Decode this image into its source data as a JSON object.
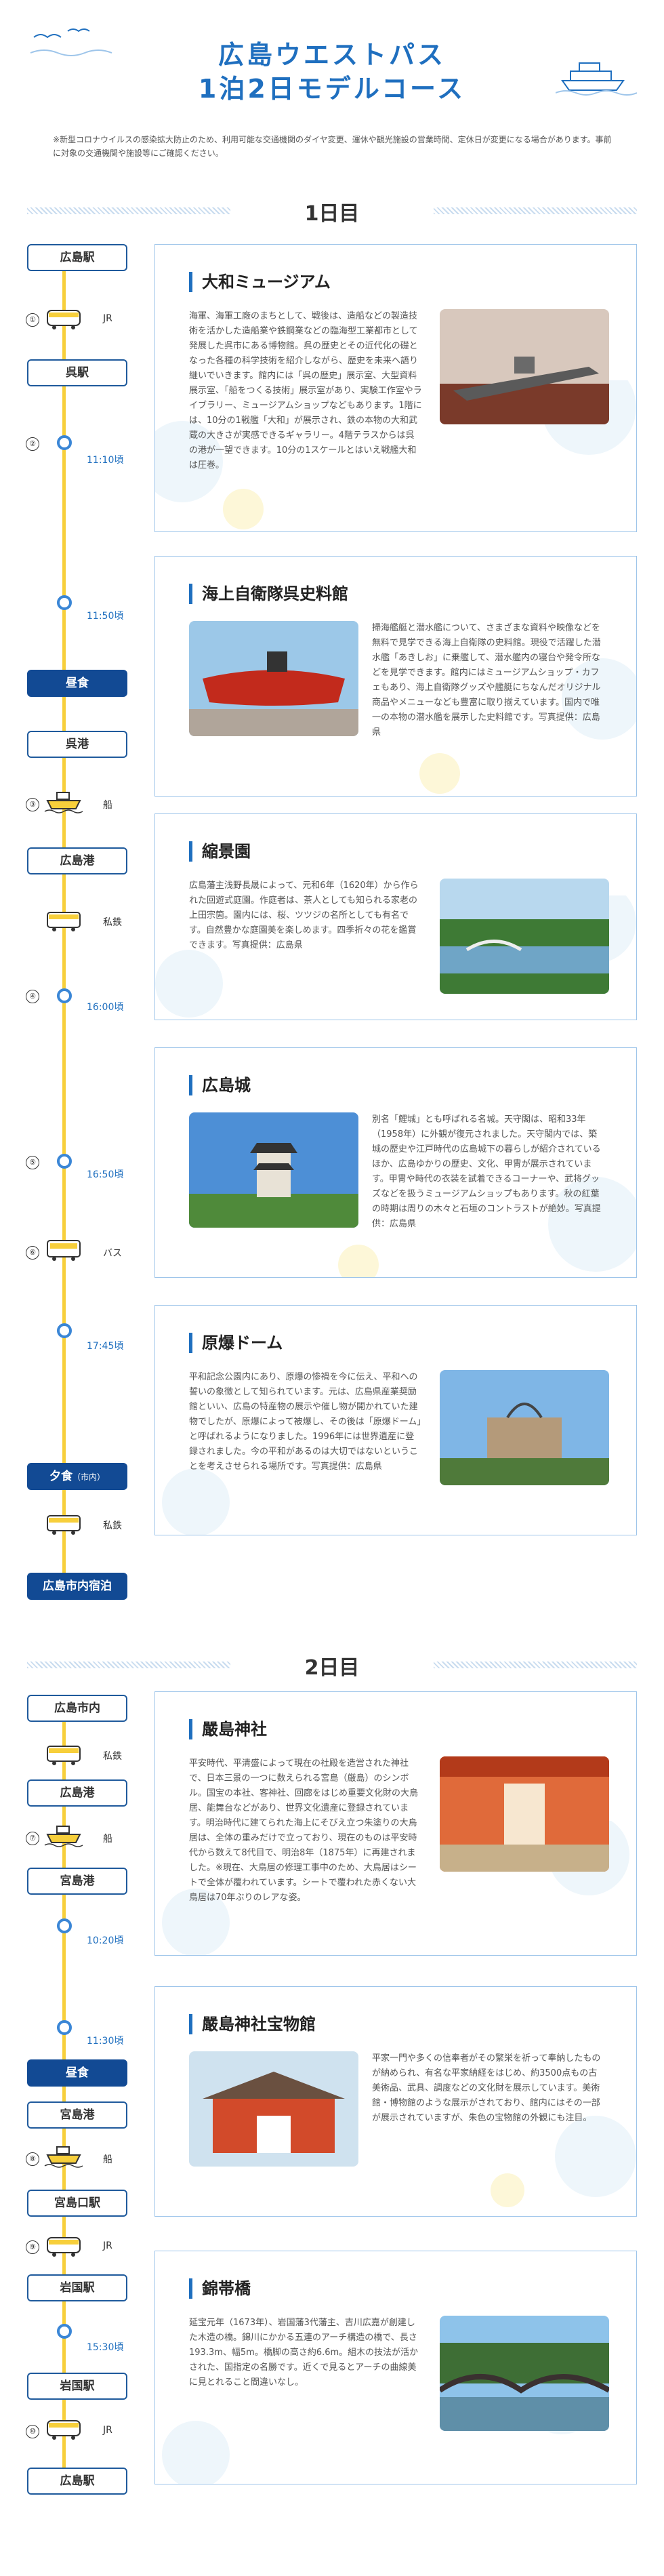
{
  "header": {
    "title_line1": "広島ウエストパス",
    "title_line2": "1泊2日モデルコース"
  },
  "note": "※新型コロナウイルスの感染拡大防止のため、利用可能な交通機関のダイヤ変更、運休や観光施設の営業時間、定休日が変更になる場合があります。事前に対象の交通機関や施設等にご確認ください。",
  "day1": {
    "label": "1日目",
    "timeline": {
      "station1": "広島駅",
      "n1": "①",
      "m1": "JR",
      "station2": "呉駅",
      "n2": "②",
      "t1": "11:10頃",
      "t2": "11:50頃",
      "meal1": "昼食",
      "station3": "呉港",
      "n3": "③",
      "m3": "船",
      "station4": "広島港",
      "m4": "私鉄",
      "n4": "④",
      "t3": "16:00頃",
      "n5": "⑤",
      "t4": "16:50頃",
      "n6": "⑥",
      "m6": "バス",
      "t5": "17:45頃",
      "meal2": "夕食",
      "meal2_sub": "（市内）",
      "m7": "私鉄",
      "stay": "広島市内宿泊"
    },
    "spots": [
      {
        "name": "大和ミュージアム",
        "desc": "海軍、海軍工廠のまちとして、戦後は、造船などの製造技術を活かした造船業や鉄鋼業などの臨海型工業都市として発展した呉市にある博物館。呉の歴史とその近代化の礎となった各種の科学技術を紹介しながら、歴史を未来へ語り継いでいきます。館内には「呉の歴史」展示室、大型資料展示室、「船をつくる技術」展示室があり、実験工作室やライブラリー、ミュージアムショップなどもあります。1階には、10分の1戦艦「大和」が展示され、鉄の本物の大和武蔵の大きさが実感できるギャラリー。4階テラスからは呉の港が一望できます。10分の1スケールとはいえ戦艦大和は圧巻。"
      },
      {
        "name": "海上自衛隊呉史料館",
        "desc": "掃海艦艇と潜水艦について、さまざまな資料や映像などを無料で見学できる海上自衛隊の史料館。現役で活躍した潜水艦「あきしお」に乗艦して、潜水艦内の寝台や発令所などを見学できます。館内にはミュージアムショップ・カフェもあり、海上自衛隊グッズや艦艇にちなんだオリジナル商品やメニューなども豊富に取り揃えています。国内で唯一の本物の潜水艦を展示した史料館です。写真提供：広島県"
      },
      {
        "name": "縮景園",
        "desc": "広島藩主浅野長晟によって、元和6年（1620年）から作られた回遊式庭園。作庭者は、茶人としても知られる家老の上田宗箇。園内には、桜、ツツジの名所としても有名です。自然豊かな庭園美を楽しめます。四季折々の花を鑑賞できます。写真提供：広島県"
      },
      {
        "name": "広島城",
        "desc": "別名「鯉城」とも呼ばれる名城。天守閣は、昭和33年（1958年）に外観が復元されました。天守閣内では、築城の歴史や江戸時代の広島城下の暮らしが紹介されているほか、広島ゆかりの歴史、文化、甲冑が展示されています。甲冑や時代の衣装を試着できるコーナーや、武将グッズなどを扱うミュージアムショップもあります。秋の紅葉の時期は周りの木々と石垣のコントラストが絶妙。写真提供：広島県"
      },
      {
        "name": "原爆ドーム",
        "desc": "平和記念公園内にあり、原爆の惨禍を今に伝え、平和への誓いの象徴として知られています。元は、広島県産業奨励館といい、広島の特産物の展示や催し物が開かれていた建物でしたが、原爆によって被爆し、その後は「原爆ドーム」と呼ばれるようになりました。1996年には世界遺産に登録されました。今の平和があるのは大切ではないということを考えさせられる場所です。写真提供：広島県"
      }
    ]
  },
  "day2": {
    "label": "2日目",
    "timeline": {
      "station1": "広島市内",
      "m1": "私鉄",
      "station2": "広島港",
      "n7": "⑦",
      "m2": "船",
      "station3": "宮島港",
      "t1": "10:20頃",
      "t2": "11:30頃",
      "meal": "昼食",
      "station4": "宮島港",
      "n8": "⑧",
      "m3": "船",
      "station5": "宮島口駅",
      "n9": "⑨",
      "m4": "JR",
      "station6": "岩国駅",
      "t3": "15:30頃",
      "station7": "岩国駅",
      "n10": "⑩",
      "m5": "JR",
      "station8": "広島駅"
    },
    "spots": [
      {
        "name": "嚴島神社",
        "desc": "平安時代、平清盛によって現在の社殿を造営された神社で、日本三景の一つに数えられる宮島（厳島）のシンボル。国宝の本社、客神社、回廊をはじめ重要文化財の大鳥居、能舞台などがあり、世界文化遺産に登録されています。明治時代に建てられた海上にそびえ立つ朱塗りの大鳥居は、全体の重みだけで立っており、現在のものは平安時代から数えて8代目で、明治8年（1875年）に再建されました。※現在、大鳥居の修理工事中のため、大鳥居はシートで全体が覆われています。シートで覆われた赤くない大鳥居は70年ぶりのレアな姿。"
      },
      {
        "name": "嚴島神社宝物館",
        "desc": "平家一門や多くの信奉者がその繁栄を祈って奉納したものが納められ、有名な平家納経をはじめ、約3500点もの古美術品、武具、調度などの文化財を展示しています。美術館・博物館のような展示がされており、館内にはその一部が展示されていますが、朱色の宝物館の外観にも注目。"
      },
      {
        "name": "錦帯橋",
        "desc": "延宝元年（1673年）、岩国藩3代藩主、吉川広嘉が創建した木造の橋。錦川にかかる五連のアーチ構造の橋で、長さ193.3m、幅5m。橋脚の高さ約6.6m。組木の技法が活かされた、国指定の名勝です。近くで見るとアーチの曲線美に見とれること間違いなし。"
      }
    ]
  },
  "colors": {
    "accent": "#1f6fbf",
    "rail": "#f7cf3b",
    "meal_bg": "#124a94",
    "card_border": "#9ec5ea"
  }
}
